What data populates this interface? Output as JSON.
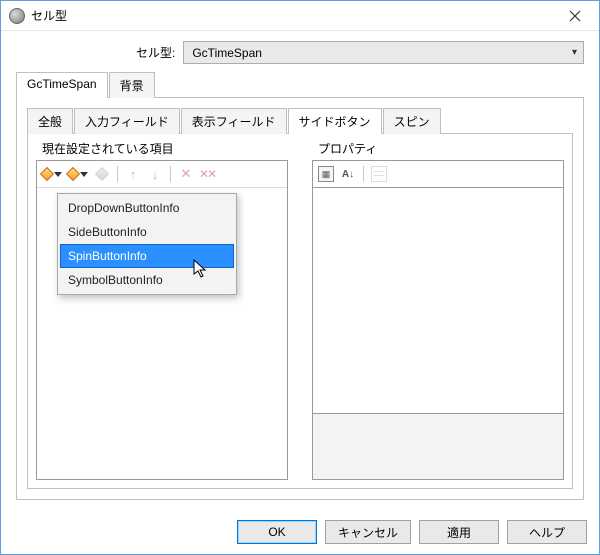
{
  "titlebar": {
    "title": "セル型"
  },
  "cell_type": {
    "label": "セル型:",
    "selected": "GcTimeSpan"
  },
  "outer_tabs": [
    {
      "label": "GcTimeSpan",
      "active": true
    },
    {
      "label": "背景",
      "active": false
    }
  ],
  "inner_tabs": [
    {
      "label": "全般"
    },
    {
      "label": "入力フィールド"
    },
    {
      "label": "表示フィールド"
    },
    {
      "label": "サイドボタン",
      "active": true
    },
    {
      "label": "スピン"
    }
  ],
  "panels": {
    "items": {
      "label": "現在設定されている項目"
    },
    "properties": {
      "label": "プロパティ"
    }
  },
  "dropdown": {
    "items": [
      {
        "label": "DropDownButtonInfo"
      },
      {
        "label": "SideButtonInfo"
      },
      {
        "label": "SpinButtonInfo",
        "selected": true
      },
      {
        "label": "SymbolButtonInfo"
      }
    ]
  },
  "buttons": {
    "ok": "OK",
    "cancel": "キャンセル",
    "apply": "適用",
    "help": "ヘルプ"
  }
}
